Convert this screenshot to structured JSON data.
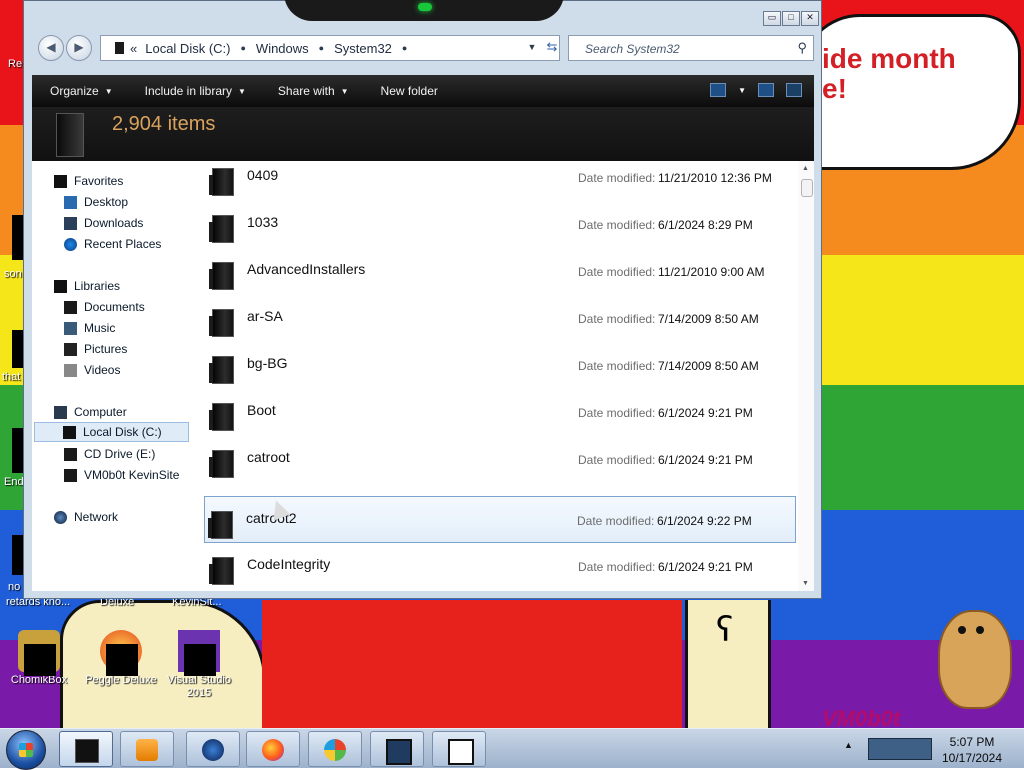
{
  "desktop": {
    "speech_text_line1": "ide month",
    "speech_text_line2": "e!",
    "logo_text": "VM0b0t",
    "icons": [
      {
        "label": "ChomikBox"
      },
      {
        "label": "Peggle Deluxe"
      },
      {
        "label": "Visual Studio 2015"
      }
    ],
    "partial_labels": {
      "top_left": "Re",
      "mid_left_1": "son",
      "mid_left_2": "that",
      "mid_left_3": "End",
      "bottom_left_1": "no",
      "bottom_left_2": "retards kno...",
      "bottom_mid_1": "Deluxe",
      "bottom_mid_2": "KevinSit..."
    }
  },
  "explorer": {
    "caption_buttons": {
      "minimize": "▭",
      "maximize": "□",
      "close": "✕"
    },
    "address": {
      "segments": [
        "Local Disk (C:)",
        "Windows",
        "System32"
      ],
      "leading_chevron": "«"
    },
    "search": {
      "placeholder": "Search System32"
    },
    "toolbar": {
      "organize": "Organize",
      "include_in_library": "Include in library",
      "share_with": "Share with",
      "new_folder": "New folder"
    },
    "details": {
      "item_count": "2,904 items"
    },
    "nav": {
      "favorites": "Favorites",
      "desktop": "Desktop",
      "downloads": "Downloads",
      "recent_places": "Recent Places",
      "libraries": "Libraries",
      "documents": "Documents",
      "music": "Music",
      "pictures": "Pictures",
      "videos": "Videos",
      "computer": "Computer",
      "local_disk": "Local Disk (C:)",
      "cd_drive": "CD Drive (E:)",
      "vm_site": "VM0b0t KevinSite",
      "network": "Network"
    },
    "date_label": "Date modified:",
    "files": [
      {
        "name": "0409",
        "date": "11/21/2010 12:36 PM"
      },
      {
        "name": "1033",
        "date": "6/1/2024 8:29 PM"
      },
      {
        "name": "AdvancedInstallers",
        "date": "11/21/2010 9:00 AM"
      },
      {
        "name": "ar-SA",
        "date": "7/14/2009 8:50 AM"
      },
      {
        "name": "bg-BG",
        "date": "7/14/2009 8:50 AM"
      },
      {
        "name": "Boot",
        "date": "6/1/2024 9:21 PM"
      },
      {
        "name": "catroot",
        "date": "6/1/2024 9:21 PM"
      },
      {
        "name": "catroot2",
        "date": "6/1/2024 9:22 PM"
      },
      {
        "name": "CodeIntegrity",
        "date": "6/1/2024 9:21 PM"
      }
    ]
  },
  "taskbar": {
    "clock_time": "5:07 PM",
    "clock_date": "10/17/2024"
  },
  "colors": {
    "command_bar": "#111111",
    "item_count_text": "#d9a25e",
    "selection": "#dfecf8"
  }
}
